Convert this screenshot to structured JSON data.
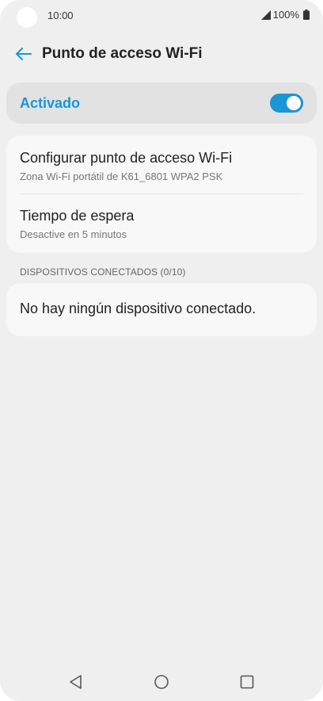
{
  "status_bar": {
    "time": "10:00",
    "battery": "100%",
    "icons": [
      "signal-icon",
      "battery-icon"
    ]
  },
  "header": {
    "title": "Punto de acceso Wi-Fi",
    "back_icon": "back-arrow-icon"
  },
  "toggle": {
    "label": "Activado",
    "state": "on",
    "accent_color": "#1a96d4"
  },
  "settings": {
    "items": [
      {
        "title": "Configurar punto de acceso Wi-Fi",
        "subtitle": "Zona Wi-Fi portátil de K61_6801 WPA2 PSK"
      },
      {
        "title": "Tiempo de espera",
        "subtitle": "Desactive en 5 minutos"
      }
    ]
  },
  "devices": {
    "section_header": "DISPOSITIVOS CONECTADOS (0/10)",
    "empty_text": "No hay ningún dispositivo conectado."
  },
  "nav_bar": {
    "icons": [
      "back-triangle-icon",
      "home-circle-icon",
      "recent-square-icon"
    ]
  }
}
